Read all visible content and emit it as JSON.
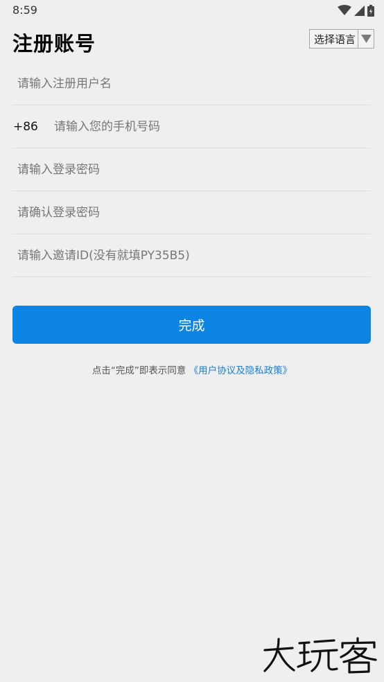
{
  "status_bar": {
    "time": "8:59",
    "icons": [
      "wifi-icon",
      "cellular-signal-icon",
      "battery-icon"
    ]
  },
  "header": {
    "title": "注册账号",
    "language_selector": {
      "label": "选择语言",
      "icon": "triangle-down-icon"
    }
  },
  "form": {
    "username_placeholder": "请输入注册用户名",
    "country_code": "+86",
    "phone_placeholder": "请输入您的手机号码",
    "password_placeholder": "请输入登录密码",
    "confirm_password_placeholder": "请确认登录密码",
    "invite_placeholder": "请输入邀请ID(没有就填PY35B5)"
  },
  "submit": {
    "label": "完成"
  },
  "agreement": {
    "prefix": "点击“完成”即表示同意 ",
    "link": "《用户协议及隐私政策》"
  },
  "watermark": {
    "text": "大玩客"
  },
  "colors": {
    "background": "#efefef",
    "primary_button": "#0b84e3",
    "link": "#1a7fd6",
    "divider": "#dedede"
  }
}
